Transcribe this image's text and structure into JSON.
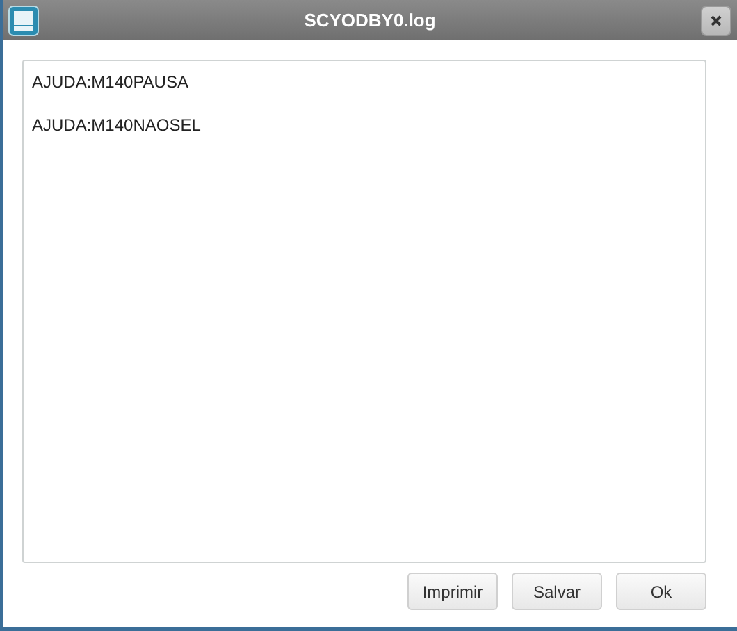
{
  "window": {
    "title": "SCYODBY0.log"
  },
  "log": {
    "lines": [
      "AJUDA:M140PAUSA",
      "AJUDA:M140NAOSEL"
    ]
  },
  "buttons": [
    "Imprimir",
    "Salvar",
    "Ok"
  ]
}
